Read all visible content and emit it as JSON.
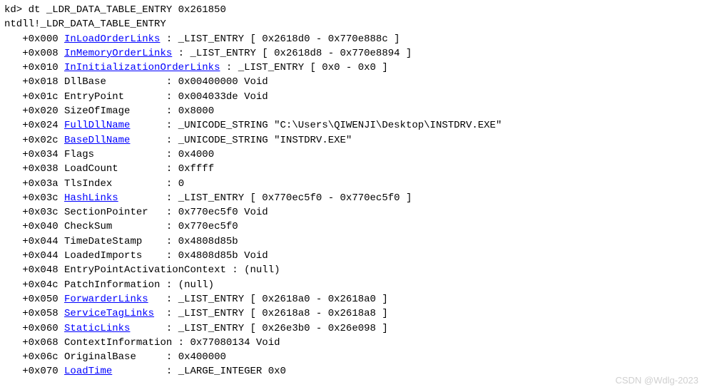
{
  "prompt": "kd> ",
  "command": "dt _LDR_DATA_TABLE_ENTRY 0x261850",
  "struct_header": "ntdll!_LDR_DATA_TABLE_ENTRY",
  "indent": "   ",
  "sep_colon": " : ",
  "entries": [
    {
      "offset": "+0x000",
      "name": "InLoadOrderLinks",
      "link": true,
      "pad": " ",
      "value": "_LIST_ENTRY [ 0x2618d0 - 0x770e888c ]"
    },
    {
      "offset": "+0x008",
      "name": "InMemoryOrderLinks",
      "link": true,
      "pad": " ",
      "value": "_LIST_ENTRY [ 0x2618d8 - 0x770e8894 ]"
    },
    {
      "offset": "+0x010",
      "name": "InInitializationOrderLinks",
      "link": true,
      "pad": " ",
      "value": "_LIST_ENTRY [ 0x0 - 0x0 ]"
    },
    {
      "offset": "+0x018",
      "name": "DllBase",
      "link": false,
      "pad": "          ",
      "value": "0x00400000 Void"
    },
    {
      "offset": "+0x01c",
      "name": "EntryPoint",
      "link": false,
      "pad": "       ",
      "value": "0x004033de Void"
    },
    {
      "offset": "+0x020",
      "name": "SizeOfImage",
      "link": false,
      "pad": "      ",
      "value": "0x8000"
    },
    {
      "offset": "+0x024",
      "name": "FullDllName",
      "link": true,
      "pad": "      ",
      "value": "_UNICODE_STRING \"C:\\Users\\QIWENJI\\Desktop\\INSTDRV.EXE\""
    },
    {
      "offset": "+0x02c",
      "name": "BaseDllName",
      "link": true,
      "pad": "      ",
      "value": "_UNICODE_STRING \"INSTDRV.EXE\""
    },
    {
      "offset": "+0x034",
      "name": "Flags",
      "link": false,
      "pad": "            ",
      "value": "0x4000"
    },
    {
      "offset": "+0x038",
      "name": "LoadCount",
      "link": false,
      "pad": "        ",
      "value": "0xffff"
    },
    {
      "offset": "+0x03a",
      "name": "TlsIndex",
      "link": false,
      "pad": "         ",
      "value": "0"
    },
    {
      "offset": "+0x03c",
      "name": "HashLinks",
      "link": true,
      "pad": "        ",
      "value": "_LIST_ENTRY [ 0x770ec5f0 - 0x770ec5f0 ]"
    },
    {
      "offset": "+0x03c",
      "name": "SectionPointer",
      "link": false,
      "pad": "   ",
      "value": "0x770ec5f0 Void"
    },
    {
      "offset": "+0x040",
      "name": "CheckSum",
      "link": false,
      "pad": "         ",
      "value": "0x770ec5f0"
    },
    {
      "offset": "+0x044",
      "name": "TimeDateStamp",
      "link": false,
      "pad": "    ",
      "value": "0x4808d85b"
    },
    {
      "offset": "+0x044",
      "name": "LoadedImports",
      "link": false,
      "pad": "    ",
      "value": "0x4808d85b Void"
    },
    {
      "offset": "+0x048",
      "name": "EntryPointActivationContext",
      "link": false,
      "pad": " ",
      "value": "(null)"
    },
    {
      "offset": "+0x04c",
      "name": "PatchInformation",
      "link": false,
      "pad": " ",
      "value": "(null)"
    },
    {
      "offset": "+0x050",
      "name": "ForwarderLinks",
      "link": true,
      "pad": "   ",
      "value": "_LIST_ENTRY [ 0x2618a0 - 0x2618a0 ]"
    },
    {
      "offset": "+0x058",
      "name": "ServiceTagLinks",
      "link": true,
      "pad": "  ",
      "value": "_LIST_ENTRY [ 0x2618a8 - 0x2618a8 ]"
    },
    {
      "offset": "+0x060",
      "name": "StaticLinks",
      "link": true,
      "pad": "      ",
      "value": "_LIST_ENTRY [ 0x26e3b0 - 0x26e098 ]"
    },
    {
      "offset": "+0x068",
      "name": "ContextInformation",
      "link": false,
      "pad": " ",
      "value": "0x77080134 Void"
    },
    {
      "offset": "+0x06c",
      "name": "OriginalBase",
      "link": false,
      "pad": "     ",
      "value": "0x400000"
    },
    {
      "offset": "+0x070",
      "name": "LoadTime",
      "link": true,
      "pad": "         ",
      "value": "_LARGE_INTEGER 0x0"
    }
  ],
  "watermark": "CSDN @Wdlg-2023"
}
